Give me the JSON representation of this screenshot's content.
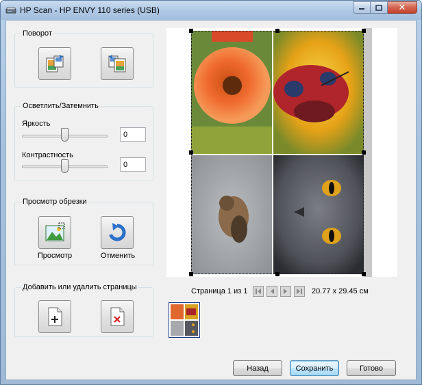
{
  "window": {
    "title": "HP Scan - HP ENVY 110 series (USB)",
    "close_glyph": "✕"
  },
  "rotate_group": {
    "title": "Поворот"
  },
  "adjust_group": {
    "title": "Осветлить/Затемнить",
    "brightness_label": "Яркость",
    "brightness_value": "0",
    "contrast_label": "Контрастность",
    "contrast_value": "0"
  },
  "crop_group": {
    "title": "Просмотр обрезки",
    "preview_label": "Просмотр",
    "undo_label": "Отменить"
  },
  "pages_group": {
    "title": "Добавить или удалить страницы"
  },
  "pager": {
    "page_text": "Страница 1 из 1",
    "size_text": "20.77 x 29.45 см"
  },
  "buttons": {
    "back": "Назад",
    "save": "Сохранить",
    "done": "Готово"
  },
  "colors": {
    "accent": "#3c7fb1",
    "delete_red": "#d42020",
    "undo_blue": "#2a6fc9"
  }
}
